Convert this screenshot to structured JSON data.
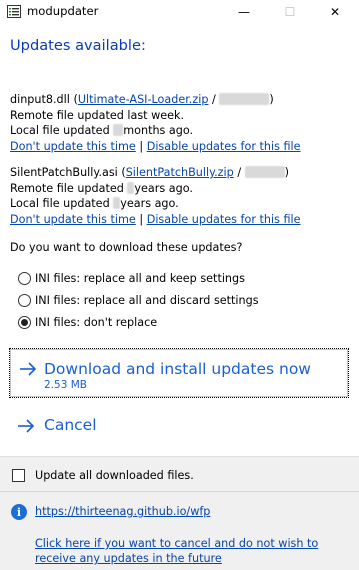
{
  "window": {
    "title": "modupdater",
    "min_glyph": "—",
    "max_glyph": "☐",
    "close_glyph": "✕",
    "icon": "app-list-icon"
  },
  "heading": "Updates available:",
  "updates": [
    {
      "file": "dinput8.dll",
      "source_link": "Ultimate-ASI-Loader.zip",
      "remote_line": "Remote file updated last week.",
      "local_prefix": "Local file updated",
      "local_suffix": "months ago.",
      "dont_update": "Don't update this time",
      "separator": "|",
      "disable": "Disable updates for this file"
    },
    {
      "file": "SilentPatchBully.asi",
      "source_link": "SilentPatchBully.zip",
      "remote_prefix": "Remote file updated",
      "remote_suffix": "years ago.",
      "local_prefix": "Local file updated",
      "local_suffix": "years ago.",
      "dont_update": "Don't update this time",
      "separator": "|",
      "disable": "Disable updates for this file"
    }
  ],
  "question": "Do you want to download these updates?",
  "radio_options": [
    {
      "label": "INI files: replace all and keep settings",
      "selected": false
    },
    {
      "label": "INI files: replace all and discard settings",
      "selected": false
    },
    {
      "label": "INI files: don't replace",
      "selected": true
    }
  ],
  "primary_command": {
    "label": "Download and install updates now",
    "sub": "2.53 MB",
    "icon": "arrow-right-icon"
  },
  "cancel_command": {
    "label": "Cancel",
    "icon": "arrow-right-icon"
  },
  "checkbox": {
    "label": "Update all downloaded files.",
    "checked": false
  },
  "footer": {
    "info_icon": "info-icon",
    "link": "https://thirteenag.github.io/wfp",
    "cancel_link": "Click here if you want to cancel and do not wish to receive any updates in the future"
  },
  "colors": {
    "accent": "#1a5fd1",
    "link": "#0645ad",
    "heading": "#0a3bb5",
    "footer_bg": "#f0f0f0"
  }
}
